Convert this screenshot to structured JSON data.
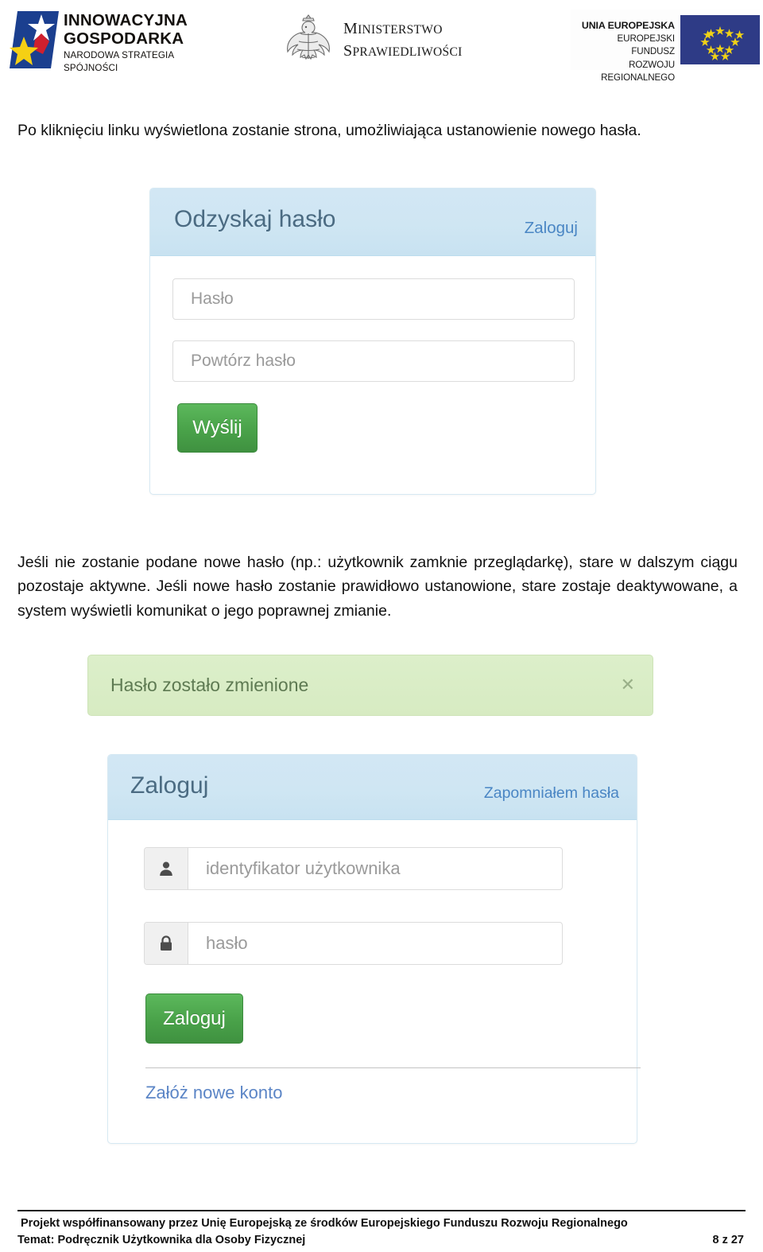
{
  "header": {
    "logo_innowacyjna": {
      "name": "innowacyjna-gospodarka-logo",
      "line1": "INNOWACYJNA",
      "line2": "GOSPODARKA",
      "line3": "NARODOWA STRATEGIA SPÓJNOŚCI"
    },
    "logo_ministerstwo": {
      "name": "ministerstwo-sprawiedliwosci-logo",
      "line1_first": "M",
      "line1_rest": "INISTERSTWO",
      "line2_first": "S",
      "line2_rest": "PRAWIEDLIWOŚCI"
    },
    "logo_eu": {
      "name": "unia-europejska-logo",
      "line1": "UNIA EUROPEJSKA",
      "line2": "EUROPEJSKI FUNDUSZ",
      "line3": "ROZWOJU REGIONALNEGO"
    }
  },
  "body": {
    "paragraph_intro": "Po kliknięciu linku wyświetlona zostanie strona, umożliwiająca ustanowienie nowego hasła.",
    "paragraph_middle": "Jeśli nie zostanie podane nowe hasło (np.: użytkownik zamknie przeglądarkę), stare w dalszym ciągu pozostaje aktywne. Jeśli nowe hasło zostanie prawidłowo ustanowione, stare zostaje deaktywowane, a system wyświetli komunikat o jego poprawnej zmianie."
  },
  "screenshot_recover": {
    "title": "Odzyskaj hasło",
    "header_link": "Zaloguj",
    "password_placeholder": "Hasło",
    "repeat_password_placeholder": "Powtórz hasło",
    "submit_label": "Wyślij"
  },
  "screenshot_login": {
    "alert": {
      "message": "Hasło zostało zmienione",
      "close_glyph": "✕"
    },
    "title": "Zaloguj",
    "header_link": "Zapomniałem hasła",
    "username_placeholder": "identyfikator użytkownika",
    "username_icon": "user-icon",
    "password_placeholder": "hasło",
    "password_icon": "lock-icon",
    "submit_label": "Zaloguj",
    "new_account_link": "Załóż nowe konto"
  },
  "footer": {
    "line1": "Projekt współfinansowany przez Unię Europejską ze środków Europejskiego Funduszu Rozwoju Regionalnego",
    "line2": "Temat: Podręcznik Użytkownika dla Osoby Fizycznej",
    "page": "8 z 27"
  },
  "colors": {
    "panel_header_blue": "#cfe6f3",
    "panel_border_blue": "#d6e9f3",
    "link_blue": "#4a86c4",
    "button_green": "#4aa34a",
    "alert_green_bg": "#d9ecc6",
    "alert_green_text": "#5e7a52",
    "eu_flag_blue": "#2e3b86",
    "eu_star_yellow": "#f0d216"
  }
}
